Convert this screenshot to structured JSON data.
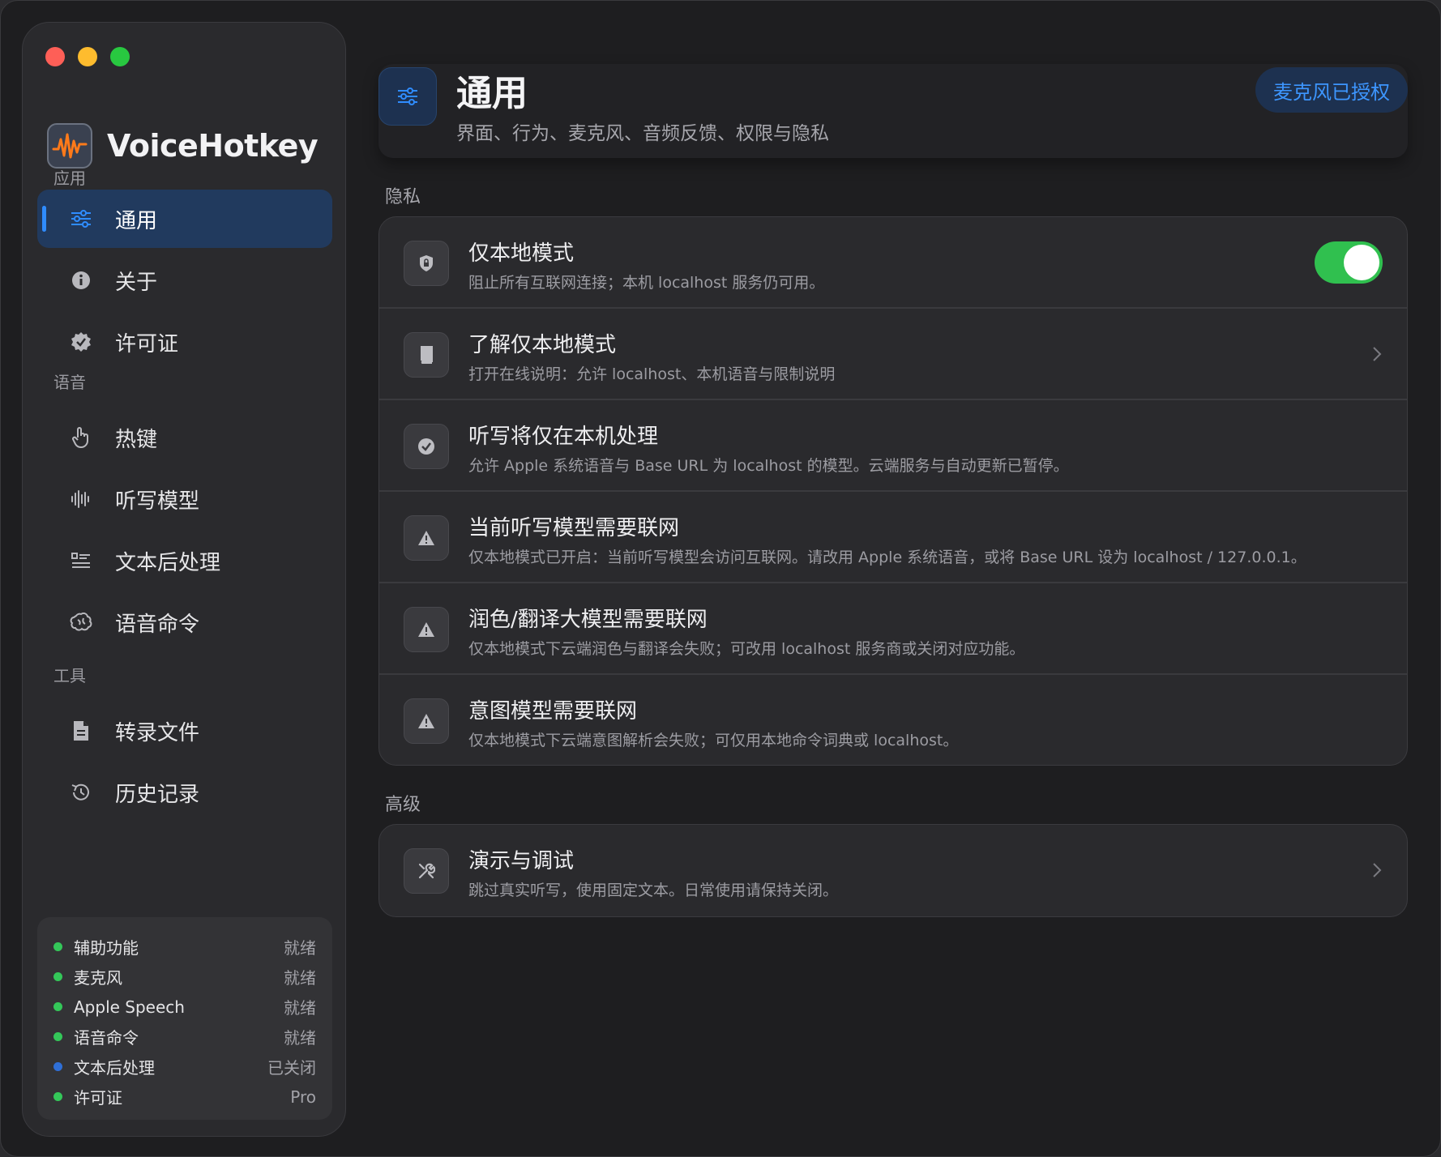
{
  "app": {
    "name": "VoiceHotkey"
  },
  "sidebar": {
    "sections": [
      {
        "label": "应用",
        "items": [
          {
            "label": "通用",
            "icon": "sliders-icon",
            "active": true
          },
          {
            "label": "关于",
            "icon": "info-icon"
          },
          {
            "label": "许可证",
            "icon": "seal-check-icon"
          }
        ]
      },
      {
        "label": "语音",
        "items": [
          {
            "label": "热键",
            "icon": "hand-pointer-icon"
          },
          {
            "label": "听写模型",
            "icon": "waveform-icon"
          },
          {
            "label": "文本后处理",
            "icon": "text-list-icon"
          },
          {
            "label": "语音命令",
            "icon": "brain-icon"
          }
        ]
      },
      {
        "label": "工具",
        "items": [
          {
            "label": "转录文件",
            "icon": "document-icon"
          },
          {
            "label": "历史记录",
            "icon": "history-icon"
          }
        ]
      }
    ],
    "status": [
      {
        "name": "辅助功能",
        "value": "就绪",
        "color": "#34c759"
      },
      {
        "name": "麦克风",
        "value": "就绪",
        "color": "#34c759"
      },
      {
        "name": "Apple Speech",
        "value": "就绪",
        "color": "#34c759"
      },
      {
        "name": "语音命令",
        "value": "就绪",
        "color": "#34c759"
      },
      {
        "name": "文本后处理",
        "value": "已关闭",
        "color": "#2f6fd6"
      },
      {
        "name": "许可证",
        "value": "Pro",
        "color": "#34c759"
      }
    ]
  },
  "header": {
    "title": "通用",
    "subtitle": "界面、行为、麦克风、音频反馈、权限与隐私",
    "mic_badge": "麦克风已授权"
  },
  "privacy": {
    "label": "隐私",
    "rows": [
      {
        "title": "仅本地模式",
        "desc": "阻止所有互联网连接；本机 localhost 服务仍可用。",
        "icon": "lock-shield-icon",
        "control": "toggle",
        "on": true
      },
      {
        "title": "了解仅本地模式",
        "desc": "打开在线说明：允许 localhost、本机语音与限制说明",
        "icon": "book-icon",
        "control": "chevron"
      },
      {
        "title": "听写将仅在本机处理",
        "desc": "允许 Apple 系统语音与 Base URL 为 localhost 的模型。云端服务与自动更新已暂停。",
        "icon": "check-circle-icon",
        "control": "none"
      },
      {
        "title": "当前听写模型需要联网",
        "desc": "仅本地模式已开启：当前听写模型会访问互联网。请改用 Apple 系统语音，或将 Base URL 设为 localhost / 127.0.0.1。",
        "icon": "warning-icon",
        "control": "none"
      },
      {
        "title": "润色/翻译大模型需要联网",
        "desc": "仅本地模式下云端润色与翻译会失败；可改用 localhost 服务商或关闭对应功能。",
        "icon": "warning-icon",
        "control": "none"
      },
      {
        "title": "意图模型需要联网",
        "desc": "仅本地模式下云端意图解析会失败；可仅用本地命令词典或 localhost。",
        "icon": "warning-icon",
        "control": "none"
      }
    ]
  },
  "advanced": {
    "label": "高级",
    "rows": [
      {
        "title": "演示与调试",
        "desc": "跳过真实听写，使用固定文本。日常使用请保持关闭。",
        "icon": "tools-icon",
        "control": "chevron"
      }
    ]
  },
  "colors": {
    "accent": "#2f8cff",
    "toggle_on": "#30c04f"
  }
}
